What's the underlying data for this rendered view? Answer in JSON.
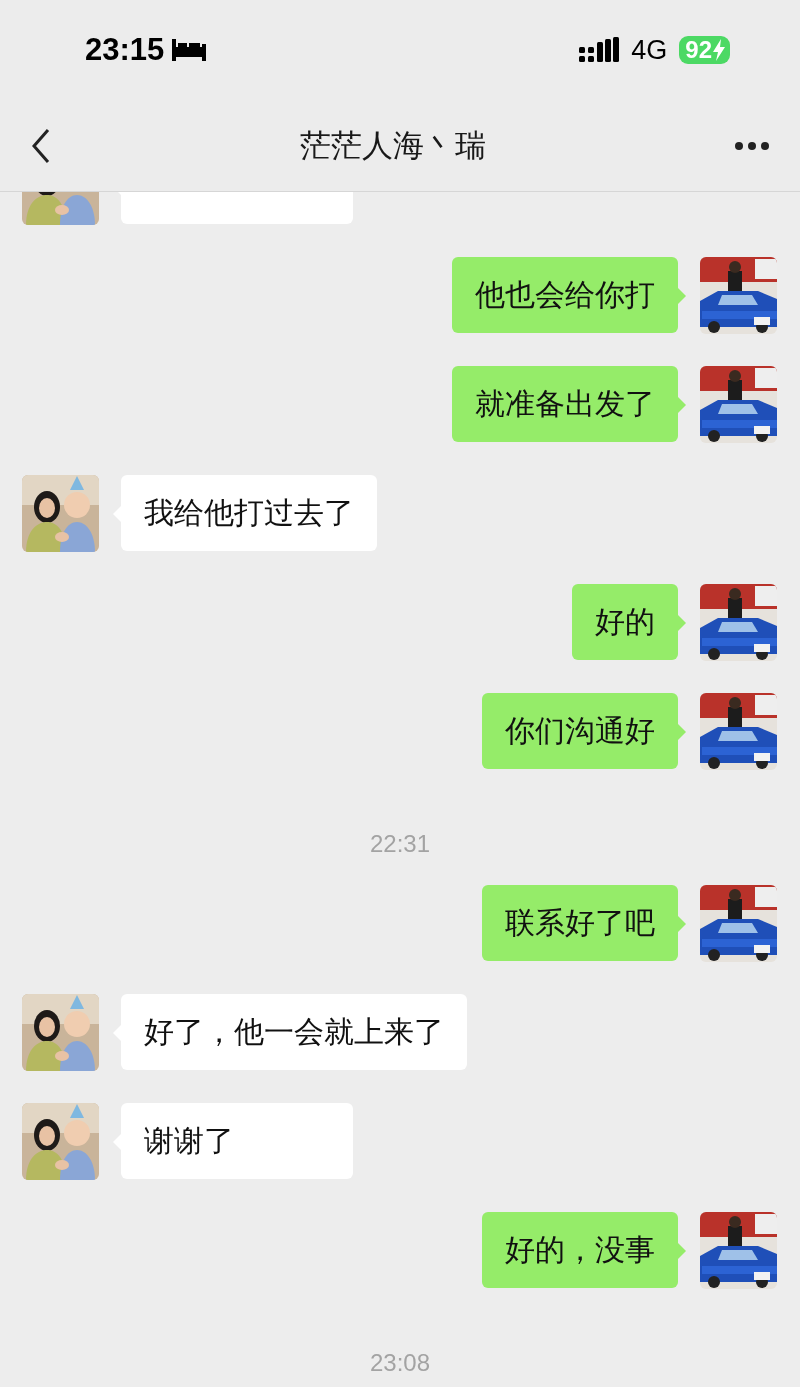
{
  "status_bar": {
    "time": "23:15",
    "network": "4G",
    "battery": "92",
    "charging": true
  },
  "header": {
    "title": "茫茫人海丶瑞"
  },
  "messages": [
    {
      "kind": "message",
      "outgoing": false
    },
    {
      "kind": "message",
      "outgoing": true,
      "text": "他也会给你打"
    },
    {
      "kind": "message",
      "outgoing": true,
      "text": "就准备出发了"
    },
    {
      "kind": "message",
      "outgoing": false,
      "text": "我给他打过去了"
    },
    {
      "kind": "message",
      "outgoing": true,
      "text": "好的"
    },
    {
      "kind": "message",
      "outgoing": true,
      "text": "你们沟通好"
    },
    {
      "kind": "time",
      "text": "22:31"
    },
    {
      "kind": "message",
      "outgoing": true,
      "text": "联系好了吧"
    },
    {
      "kind": "message",
      "outgoing": false,
      "text": "好了，他一会就上来了"
    },
    {
      "kind": "message",
      "outgoing": false,
      "text": "谢谢了"
    },
    {
      "kind": "message",
      "outgoing": true,
      "text": "好的，没事"
    },
    {
      "kind": "time",
      "text": "23:08"
    }
  ]
}
